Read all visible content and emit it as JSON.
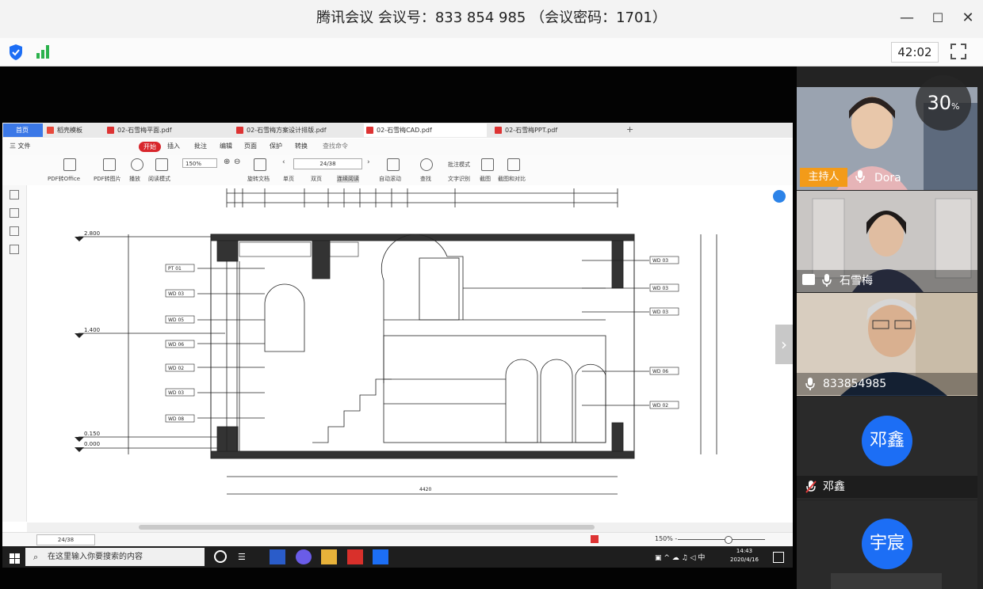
{
  "window": {
    "title": "腾讯会议 会议号：833 854 985 （会议密码：1701）",
    "minimize": "—",
    "maximize": "☐",
    "close": "✕"
  },
  "toolbar": {
    "timer": "42:02",
    "fullscreen": "⛶"
  },
  "wps": {
    "tabs": [
      "首页",
      "稻壳模板",
      "02-石雪梅平面.pdf",
      "02-石雪梅方案设计排版.pdf",
      "02-石雪梅CAD.pdf",
      "02-石雪梅PPT.pdf"
    ],
    "menu": [
      "三 文件",
      "开始",
      "插入",
      "批注",
      "编辑",
      "页面",
      "保护",
      "转换",
      "查找命令"
    ],
    "menu_open": "开始",
    "ribbon": [
      "PDF转Office",
      "PDF转图片",
      "播放",
      "阅读模式",
      "旋转文档",
      "单页",
      "双页",
      "连续阅读",
      "自动滚动",
      "查找",
      "批注模式",
      "文字识别",
      "截图",
      "截图和对比"
    ],
    "zoom": "150%",
    "page": "24/38",
    "status_page": "24/38",
    "status_zoom": "150% -"
  },
  "drawing": {
    "levels": [
      "2.800",
      "1.400",
      "0.150",
      "0.000"
    ],
    "tags": [
      "PT 01",
      "WD 03",
      "WD 05",
      "WD 06",
      "WD 02",
      "WD 03",
      "WD 08"
    ],
    "right_tags": [
      "WD 03",
      "WD 03",
      "WD 03",
      "WD 06",
      "WD 02"
    ],
    "bottom_total": "4420"
  },
  "taskbar": {
    "search_placeholder": "在这里输入你要搜索的内容",
    "time": "14:43",
    "date": "2020/4/16"
  },
  "participants": [
    {
      "name": "Dora",
      "role": "主持人",
      "muted": false
    },
    {
      "name": "石雪梅",
      "muted": false
    },
    {
      "name": "833854985",
      "muted": false
    },
    {
      "name": "邓鑫",
      "avatar": "邓鑫",
      "muted": true
    },
    {
      "name": "宇宸",
      "avatar": "宇宸",
      "muted": true
    }
  ],
  "share_percent": "30",
  "share_percent_unit": "%",
  "colors": {
    "accent": "#1c6ef5",
    "host": "#f39b19",
    "wps_red": "#d8262c"
  }
}
